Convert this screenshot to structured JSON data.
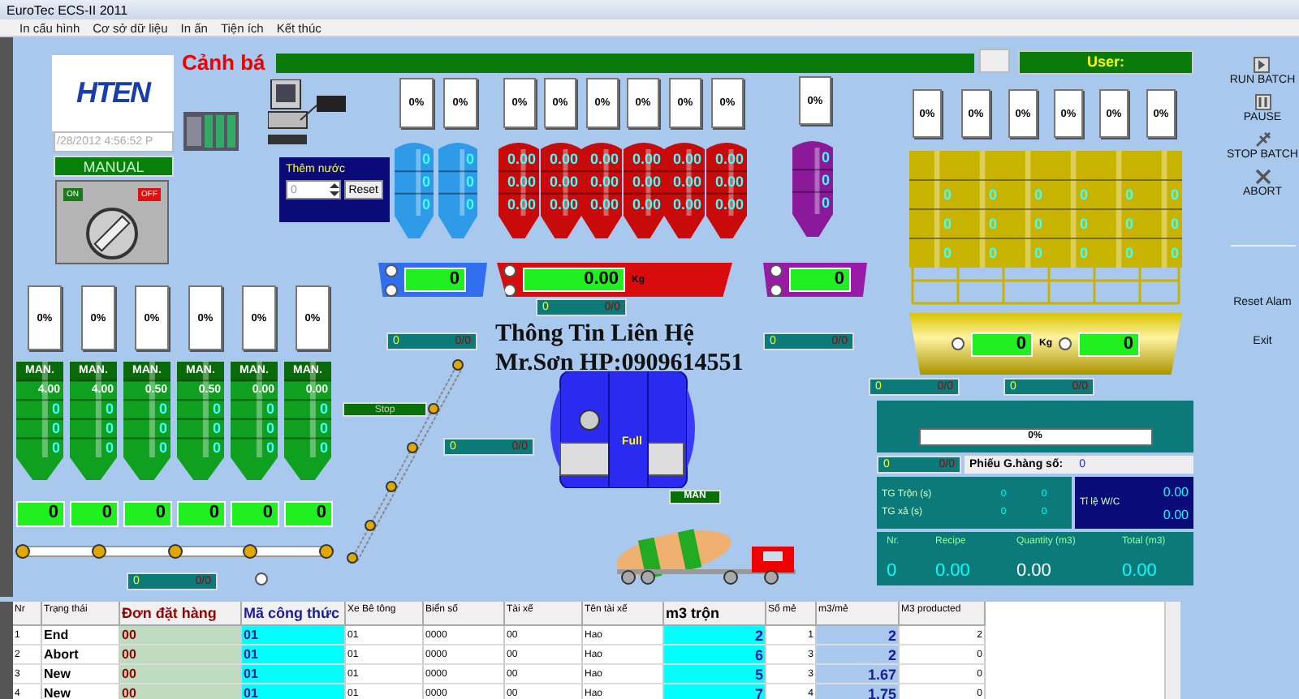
{
  "window": {
    "title": "EuroTec ECS-II 2011"
  },
  "menu": [
    {
      "label": "In cấu hình"
    },
    {
      "label": "Cơ sở dữ liệu"
    },
    {
      "label": "In ấn"
    },
    {
      "label": "Tiện ích"
    },
    {
      "label": "Kết thúc"
    }
  ],
  "header": {
    "logo": "HTEN",
    "datetime": "/28/2012  4:56:52 P",
    "mode": "MANUAL",
    "on_label": "ON",
    "off_label": "OFF",
    "switch_on": false,
    "alarm_label": "Cảnh bá",
    "user_label": "User:"
  },
  "water_add": {
    "title": "Thêm nước",
    "value": "0",
    "button": "Reset"
  },
  "silo_groups": [
    {
      "kind": "round",
      "color": "#2f9be8",
      "silos": [
        {
          "percent": "0%",
          "readings": [
            "0",
            "0",
            "0"
          ]
        },
        {
          "percent": "0%",
          "readings": [
            "0",
            "0",
            "0"
          ]
        }
      ]
    },
    {
      "kind": "round",
      "color": "#c80a0a",
      "silos": [
        {
          "percent": "0%",
          "readings": [
            "0.00",
            "0.00",
            "0.00"
          ]
        },
        {
          "percent": "0%",
          "readings": [
            "0.00",
            "0.00",
            "0.00"
          ]
        },
        {
          "percent": "0%",
          "readings": [
            "0.00",
            "0.00",
            "0.00"
          ]
        },
        {
          "percent": "0%",
          "readings": [
            "0.00",
            "0.00",
            "0.00"
          ]
        },
        {
          "percent": "0%",
          "readings": [
            "0.00",
            "0.00",
            "0.00"
          ]
        },
        {
          "percent": "0%",
          "readings": [
            "0.00",
            "0.00",
            "0.00"
          ]
        }
      ]
    },
    {
      "kind": "round",
      "color": "#8a1a9a",
      "silos": [
        {
          "percent": "0%",
          "readings": [
            "0",
            "0",
            "0"
          ]
        }
      ]
    },
    {
      "kind": "drum",
      "color": "#c8b400",
      "silos": [
        {
          "percent": "0%",
          "readings": [
            "0",
            "0",
            "0"
          ]
        },
        {
          "percent": "0%",
          "readings": [
            "0",
            "0",
            "0"
          ]
        },
        {
          "percent": "0%",
          "readings": [
            "0",
            "0",
            "0"
          ]
        },
        {
          "percent": "0%",
          "readings": [
            "0",
            "0",
            "0"
          ]
        },
        {
          "percent": "0%",
          "readings": [
            "0",
            "0",
            "0"
          ]
        },
        {
          "percent": "0%",
          "readings": [
            "0",
            "0",
            "0"
          ]
        }
      ]
    },
    {
      "kind": "bin",
      "color": "#10a020",
      "silos": [
        {
          "percent": "0%",
          "mode": "MAN.",
          "readings": [
            "4.00",
            "0",
            "0",
            "0"
          ]
        },
        {
          "percent": "0%",
          "mode": "MAN.",
          "readings": [
            "4.00",
            "0",
            "0",
            "0"
          ]
        },
        {
          "percent": "0%",
          "mode": "MAN.",
          "readings": [
            "0.50",
            "0",
            "0",
            "0"
          ]
        },
        {
          "percent": "0%",
          "mode": "MAN.",
          "readings": [
            "0.50",
            "0",
            "0",
            "0"
          ]
        },
        {
          "percent": "0%",
          "mode": "MAN.",
          "readings": [
            "0.00",
            "0",
            "0",
            "0"
          ]
        },
        {
          "percent": "0%",
          "mode": "MAN.",
          "readings": [
            "0.00",
            "0",
            "0",
            "0"
          ]
        }
      ]
    }
  ],
  "scales": [
    {
      "color": "#2f6ff0",
      "value": "0"
    },
    {
      "color": "#d80c0c",
      "value": "0.00",
      "unit": "Kg"
    },
    {
      "color": "#9a1aa8",
      "value": "0"
    }
  ],
  "aggregate_scale": {
    "values": [
      "0",
      "0"
    ],
    "unit": "Kg"
  },
  "bin_scales": [
    {
      "value": "0"
    },
    {
      "value": "0"
    },
    {
      "value": "0"
    },
    {
      "value": "0"
    },
    {
      "value": "0"
    },
    {
      "value": "0"
    }
  ],
  "status_bars": [
    {
      "count": "0",
      "ratio": "0/0"
    },
    {
      "count": "0",
      "ratio": "0/0"
    },
    {
      "count": "0",
      "ratio": "0/0"
    },
    {
      "count": "0",
      "ratio": "0/0"
    },
    {
      "count": "0",
      "ratio": "0/0"
    },
    {
      "count": "0",
      "ratio": "0/0"
    },
    {
      "count": "0",
      "ratio": "0/0"
    }
  ],
  "conveyor": {
    "state": "Stop"
  },
  "contact": {
    "line_1": "Thông Tin Liên Hệ",
    "line_2": "Mr.Sơn HP:0909614551"
  },
  "mixer": {
    "state": "Full",
    "mode": "MAN"
  },
  "batch_panel": {
    "progress": {
      "label": "0%",
      "level": 0
    },
    "status": {
      "count": "0",
      "ratio": "0/0"
    },
    "ticket_label": "Phiếu G.hàng số:",
    "ticket_value": "0",
    "timers": [
      {
        "label": "TG Trộn (s)",
        "values": [
          "0",
          "0"
        ]
      },
      {
        "label": "TG xả (s)",
        "values": [
          "0",
          "0"
        ]
      }
    ],
    "wc_label": "Tỉ lệ W/C",
    "wc_values": [
      "0.00",
      "0.00"
    ],
    "summary_headers": [
      "Nr.",
      "Recipe",
      "Quantity (m3)",
      "Total (m3)"
    ],
    "summary_values": [
      "0",
      "0.00",
      "0.00",
      "0.00"
    ]
  },
  "side_buttons": [
    {
      "kind": "play",
      "label": "RUN BATCH"
    },
    {
      "kind": "pause",
      "label": "PAUSE"
    },
    {
      "kind": "stop",
      "label": "STOP BATCH"
    },
    {
      "kind": "abort",
      "label": "ABORT"
    },
    {
      "kind": "text",
      "label": "Reset Alam"
    },
    {
      "kind": "text",
      "label": "Exit"
    }
  ],
  "table": {
    "columns": [
      "Nr",
      "Trạng thái",
      "Đơn đặt hàng",
      "Mã công thức",
      "Xe Bê tông",
      "Biển số",
      "Tài xế",
      "Tên tài xế",
      "m3 trộn",
      "Số mẻ",
      "m3/mẻ",
      "M3 producted"
    ],
    "rows": [
      [
        "1",
        "End",
        "00",
        "01",
        "01",
        "0000",
        "00",
        "Hao",
        "2",
        "1",
        "2",
        "2"
      ],
      [
        "2",
        "Abort",
        "00",
        "01",
        "01",
        "0000",
        "00",
        "Hao",
        "6",
        "3",
        "2",
        "0"
      ],
      [
        "3",
        "New",
        "00",
        "01",
        "01",
        "0000",
        "00",
        "Hao",
        "5",
        "3",
        "1.67",
        "0"
      ],
      [
        "4",
        "New",
        "00",
        "01",
        "01",
        "0000",
        "00",
        "Hao",
        "7",
        "4",
        "1.75",
        "0"
      ]
    ]
  }
}
